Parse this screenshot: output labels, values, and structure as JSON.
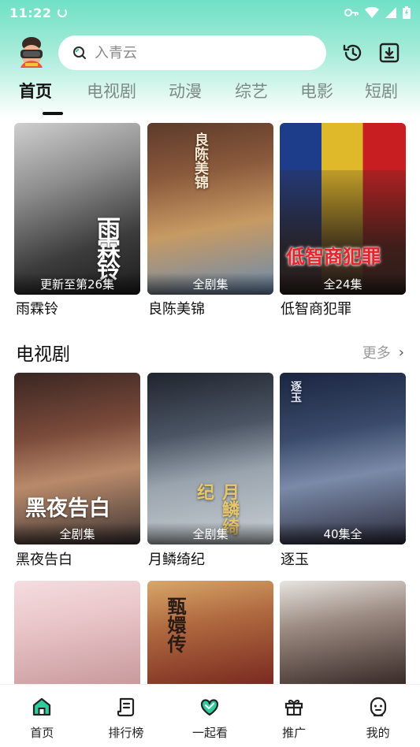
{
  "status": {
    "time": "11:22"
  },
  "search": {
    "placeholder": "入青云"
  },
  "tabs": [
    "首页",
    "电视剧",
    "动漫",
    "综艺",
    "电影",
    "短剧"
  ],
  "featured": [
    {
      "title": "雨霖铃",
      "badge": "更新至第26集",
      "art": "雨霖铃"
    },
    {
      "title": "良陈美锦",
      "badge": "全剧集",
      "art": "良陈美锦"
    },
    {
      "title": "低智商犯罪",
      "badge": "全24集",
      "art": "低智商犯罪"
    }
  ],
  "tv_section": {
    "title": "电视剧",
    "more": "更多"
  },
  "tv_shows": [
    {
      "title": "黑夜告白",
      "badge": "全剧集",
      "art": "黑夜告白"
    },
    {
      "title": "月鳞绮纪",
      "badge": "全剧集",
      "art": "月鳞绮纪"
    },
    {
      "title": "逐玉",
      "badge": "40集全",
      "art": "逐玉"
    }
  ],
  "third_row": [
    {
      "art": ""
    },
    {
      "art": "甄嬛传"
    },
    {
      "art": ""
    }
  ],
  "bottom_nav": [
    {
      "label": "首页",
      "icon": "home-icon"
    },
    {
      "label": "排行榜",
      "icon": "ranking-icon"
    },
    {
      "label": "一起看",
      "icon": "heart-icon"
    },
    {
      "label": "推广",
      "icon": "gift-icon"
    },
    {
      "label": "我的",
      "icon": "profile-icon"
    }
  ],
  "colors": {
    "accent": "#2ecc9a",
    "header_gradient": "#6fe0c6",
    "nav_active": "#2ecc9a"
  }
}
